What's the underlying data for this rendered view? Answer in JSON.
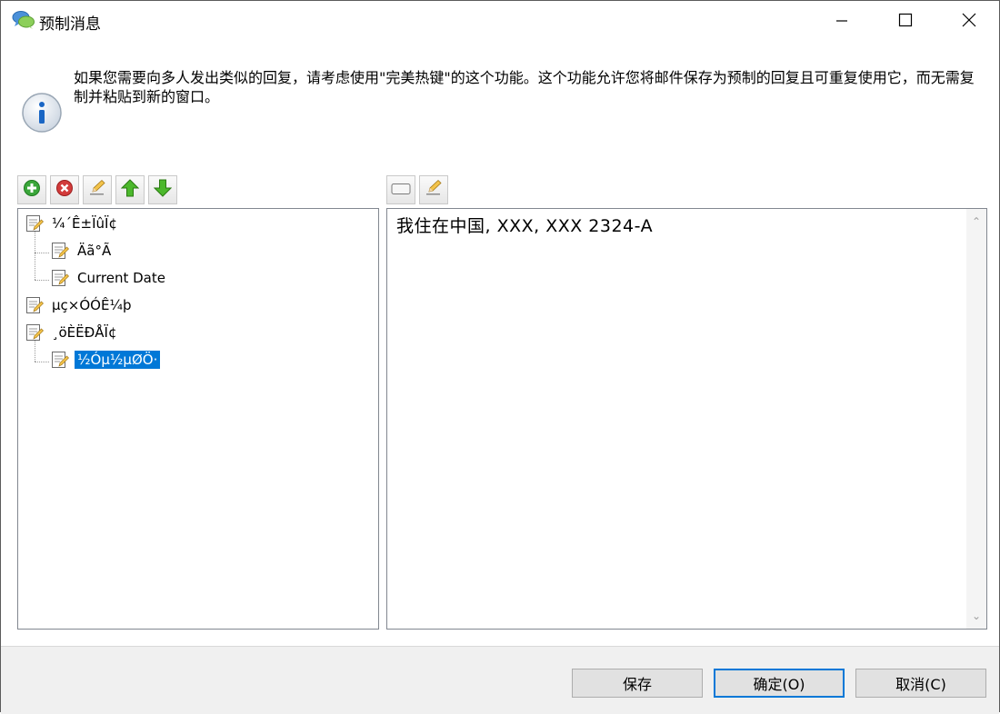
{
  "window": {
    "title": "预制消息",
    "caption_min_icon": "minimize-icon",
    "caption_max_icon": "maximize-icon",
    "caption_close_icon": "close-icon"
  },
  "info": {
    "text": "如果您需要向多人发出类似的回复，请考虑使用\"完美热键\"的这个功能。这个功能允许您将邮件保存为预制的回复且可重复使用它，而无需复制并粘贴到新的窗口。"
  },
  "toolbar_left": [
    "add-icon",
    "delete-icon",
    "edit-icon",
    "move-up-icon",
    "move-down-icon"
  ],
  "toolbar_right": [
    "text-field-icon",
    "edit-icon"
  ],
  "tree": {
    "items": [
      {
        "label": "¼´Ê±ÏûÏ¢",
        "level": 0
      },
      {
        "label": "Äã°Ã",
        "level": 1
      },
      {
        "label": "Current Date",
        "level": 1
      },
      {
        "label": "µç×ÓÓÊ¼þ",
        "level": 0
      },
      {
        "label": "¸öÈËÐÅÏ¢",
        "level": 0
      },
      {
        "label": "½Óµ½µØÖ·",
        "level": 1,
        "selected": true
      }
    ]
  },
  "editor": {
    "content": "我住在中国, XXX, XXX 2324-A"
  },
  "buttons": {
    "save": "保存",
    "ok": "确定(O)",
    "cancel": "取消(C)"
  },
  "colors": {
    "selection": "#0078d7",
    "dialog_bg": "#f0f0f0"
  }
}
